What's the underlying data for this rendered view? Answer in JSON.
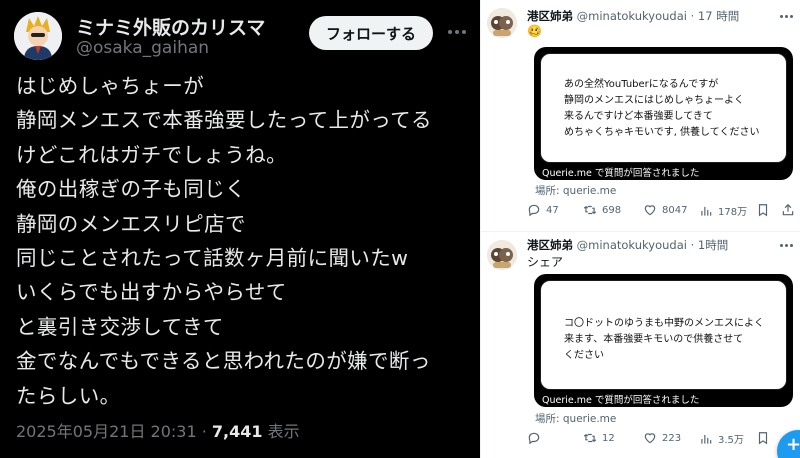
{
  "left_tweet": {
    "author_name": "ミナミ外販のカリスマ",
    "author_handle": "@osaka_gaihan",
    "follow_label": "フォローする",
    "lines": [
      "はじめしゃちょーが",
      "静岡メンエスで本番強要したって上がってる",
      "けどこれはガチでしょうね。",
      "俺の出稼ぎの子も同じく",
      "静岡のメンエスリピ店で",
      "同じことされたって話数ヶ月前に聞いたw",
      "いくらでも出すからやらせて",
      "と裏引き交渉してきて",
      "金でなんでもできると思われたのが嫌で断っ",
      "たらしい。"
    ],
    "timestamp": "2025年05月21日 20:31",
    "separator": "·",
    "views_count": "7,441",
    "views_label": "表示"
  },
  "right_tweets": [
    {
      "author_name": "港区姉弟",
      "handle": "@minatokukyoudai",
      "separator": "·",
      "time": "17 時間",
      "text": "🥴",
      "card_lines": [
        "あの全然YouTuberになるんですが",
        "静岡のメンエスにはじめしゃちょーよく",
        "来るんですけど本番強要してきて",
        "めちゃくちゃキモいです, 供養してください"
      ],
      "card_caption": "Querie.me で質問が回答されました",
      "place": "場所: querie.me",
      "replies": "47",
      "retweets": "698",
      "likes": "8047",
      "views": "178万"
    },
    {
      "author_name": "港区姉弟",
      "handle": "@minatokukyoudai",
      "separator": "·",
      "time": "1時間",
      "text": "シェア",
      "card_lines": [
        "コ〇ドットのゆうまも中野のメンエスによく",
        "来ます、本番強要キモいので供養させて",
        "ください"
      ],
      "card_caption": "Querie.me で質問が回答されました",
      "place": "場所: querie.me",
      "replies": "",
      "retweets": "12",
      "likes": "223",
      "views": "3.5万"
    }
  ],
  "fab_label": "+",
  "colors": {
    "dark_bg": "#000000",
    "dark_text": "#e7e9ea",
    "dark_muted": "#71767b",
    "light_muted": "#536471",
    "accent_blue": "#1d9bf0",
    "like_red": "#f91880"
  }
}
